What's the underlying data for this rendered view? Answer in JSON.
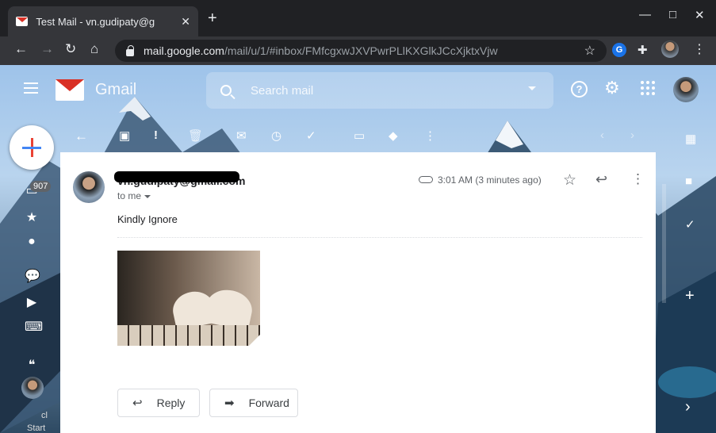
{
  "browser": {
    "tab_title": "Test Mail - vn.gudipaty@g",
    "tab_close": "✕",
    "new_tab": "+",
    "window_controls": [
      "—",
      "□",
      "✕"
    ],
    "url_host": "mail.google.com",
    "url_path": "/mail/u/1/#inbox/FMfcgxwJXVPwrPLlKXGlkJCcXjktxVjw",
    "extension_g_label": "G"
  },
  "gmail": {
    "logo_text": "Gmail",
    "search_placeholder": "Search mail",
    "help_label": "?",
    "inbox_count": "907",
    "rail_text_1": "cl",
    "rail_text_2": "Start"
  },
  "message": {
    "sender": "vn.gudipaty@gmail.com",
    "recipient": "to me",
    "timestamp": "3:01 AM (3 minutes ago)",
    "body": "Kindly Ignore",
    "reply_label": "Reply",
    "forward_label": "Forward"
  },
  "icons": {
    "back": "←",
    "forward_nav": "→",
    "reload": "↻",
    "home": "⌂",
    "star": "☆",
    "reply": "↩",
    "more": "⋮",
    "settings": "⚙",
    "archive": "▣",
    "spam": "!",
    "delete": "🗑",
    "mark_unread": "✉",
    "snooze": "◷",
    "add_task": "✓",
    "move": "▭",
    "labels": "◆",
    "prev": "‹",
    "next": "›",
    "plus": "+",
    "chevron": "›",
    "starred": "★",
    "snoozed": "●",
    "chat": "💬",
    "video": "▶",
    "keyboard": "⌨",
    "hangouts": "❝"
  },
  "colors": {
    "chrome_dark": "#202124",
    "chrome_toolbar": "#35363a",
    "gmail_red": "#d93025",
    "accent_blue": "#1a73e8"
  }
}
